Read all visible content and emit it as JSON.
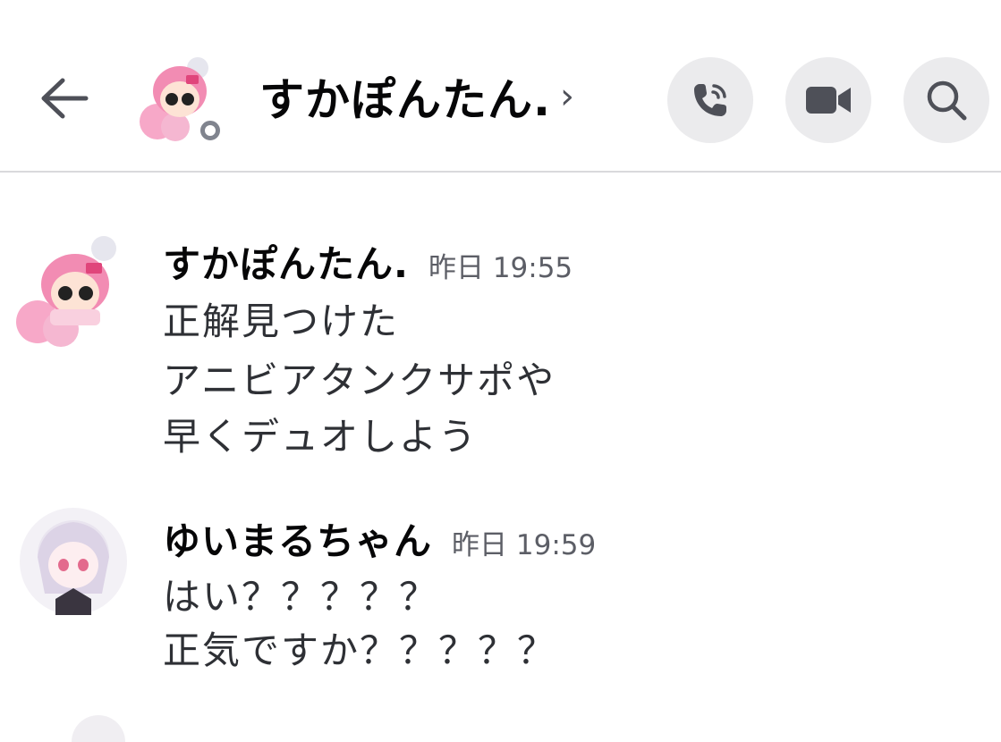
{
  "header": {
    "title": "すかぽんたん.",
    "chevron": "›",
    "icons": {
      "back": "arrow-left-icon",
      "call": "phone-call-icon",
      "video": "video-camera-icon",
      "search": "search-icon"
    },
    "colors": {
      "icon": "#4e5058",
      "button_bg": "#ebebed",
      "status": "#80848e"
    }
  },
  "messages": [
    {
      "author": "すかぽんたん.",
      "timestamp": "昨日 19:55",
      "lines": [
        "正解見つけた",
        "アニビアタンクサポや",
        "早くデュオしよう"
      ]
    },
    {
      "author": "ゆいまるちゃん",
      "timestamp": "昨日 19:59",
      "lines": [
        "はい？？？？？",
        "正気ですか？？？？？"
      ]
    }
  ]
}
